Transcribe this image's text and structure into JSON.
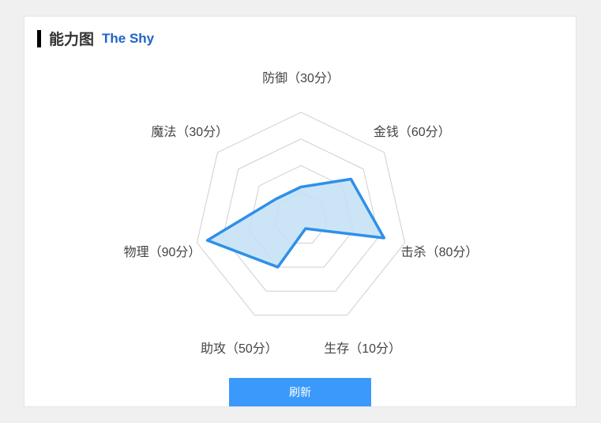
{
  "header": {
    "title": "能力图",
    "subtitle": "The Shy"
  },
  "button": {
    "refresh": "刷新"
  },
  "chart_data": {
    "type": "radar",
    "max": 100,
    "rings": [
      25,
      50,
      75,
      100
    ],
    "axes": [
      {
        "name": "防御",
        "value": 30,
        "label": "防御（30分）"
      },
      {
        "name": "金钱",
        "value": 60,
        "label": "金钱（60分）"
      },
      {
        "name": "击杀",
        "value": 80,
        "label": "击杀（80分）"
      },
      {
        "name": "生存",
        "value": 10,
        "label": "生存（10分）"
      },
      {
        "name": "助攻",
        "value": 50,
        "label": "助攻（50分）"
      },
      {
        "name": "物理",
        "value": 90,
        "label": "物理（90分）"
      },
      {
        "name": "魔法",
        "value": 30,
        "label": "魔法（30分）"
      }
    ],
    "colors": {
      "grid": "#cfcfcf",
      "fill": "#c3e0f5",
      "stroke": "#2f90e8"
    }
  }
}
